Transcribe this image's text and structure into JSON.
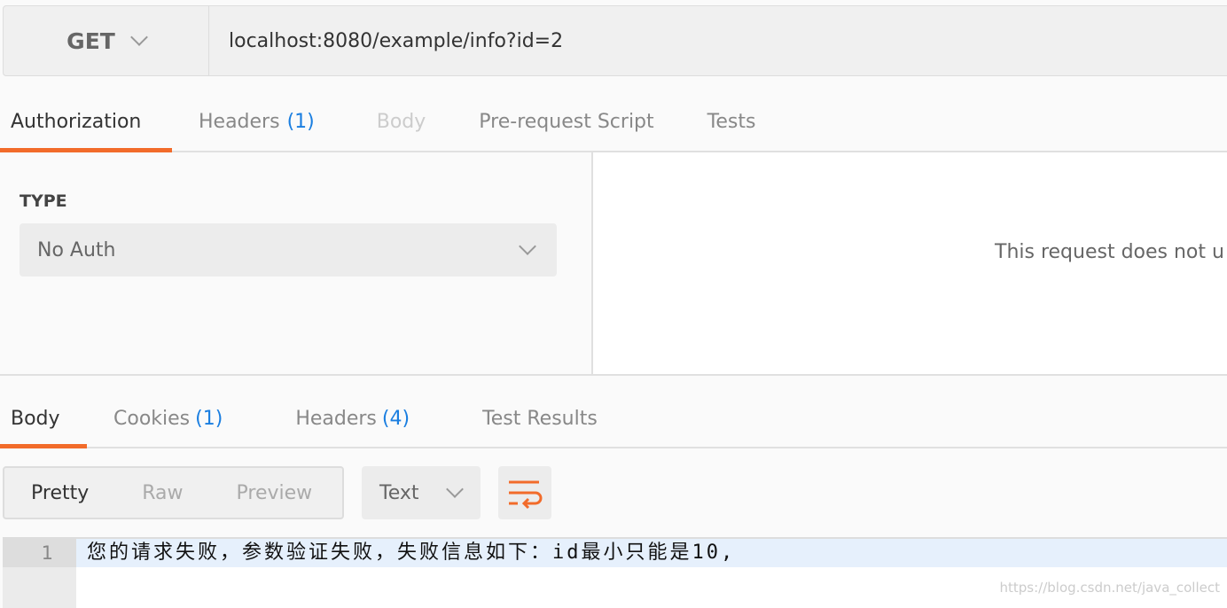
{
  "request": {
    "method": "GET",
    "url": "localhost:8080/example/info?id=2"
  },
  "request_tabs": [
    {
      "label": "Authorization"
    },
    {
      "label": "Headers",
      "count": "(1)"
    },
    {
      "label": "Body"
    },
    {
      "label": "Pre-request Script"
    },
    {
      "label": "Tests"
    }
  ],
  "auth": {
    "type_label": "TYPE",
    "type_value": "No Auth",
    "message": "This request does not u"
  },
  "response_tabs": [
    {
      "label": "Body"
    },
    {
      "label": "Cookies",
      "count": "(1)"
    },
    {
      "label": "Headers",
      "count": "(4)"
    },
    {
      "label": "Test Results"
    }
  ],
  "view_modes": [
    "Pretty",
    "Raw",
    "Preview"
  ],
  "format": "Text",
  "wrap_icon": "wrap-lines-icon",
  "editor": {
    "lines": [
      {
        "number": "1",
        "text": "您的请求失败，参数验证失败，失败信息如下：id最小只能是10,"
      }
    ]
  },
  "watermark": "https://blog.csdn.net/java_collect",
  "colors": {
    "accent": "#f26b2a",
    "count": "#1a7ee0"
  }
}
